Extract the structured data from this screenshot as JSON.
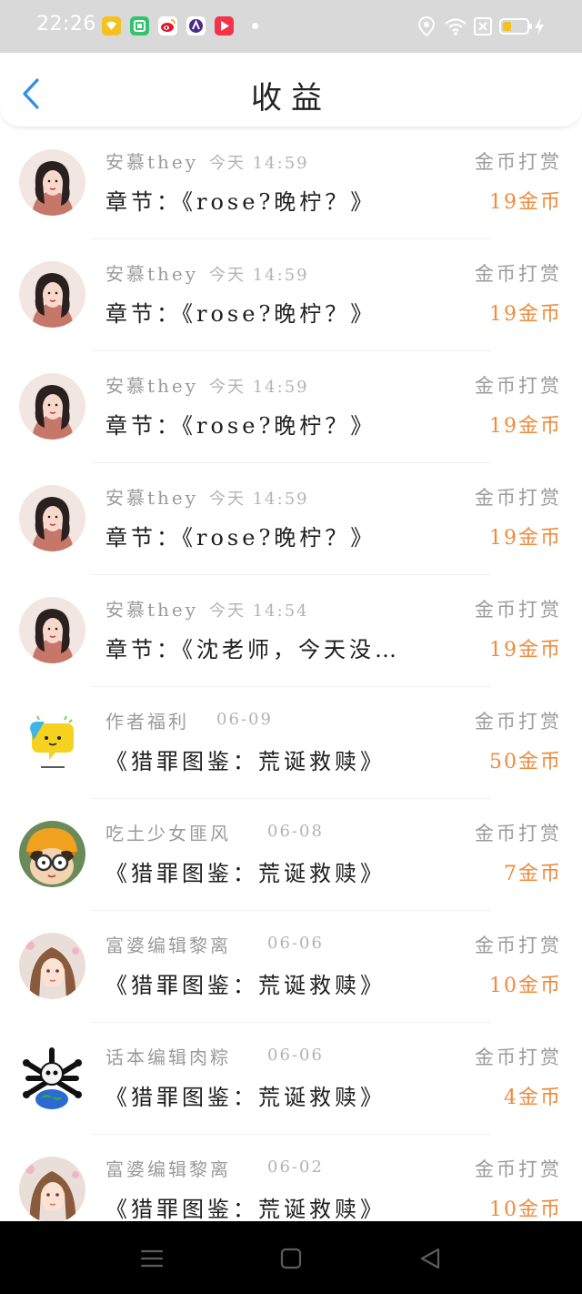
{
  "status_bar": {
    "time": "22:26",
    "notification_icons": [
      "yellow-app-icon",
      "green-app-icon",
      "weibo-icon",
      "purple-app-icon",
      "red-play-icon"
    ],
    "system_icons": [
      "location-icon",
      "wifi-icon",
      "no-sim-icon",
      "battery-icon",
      "charging-icon"
    ]
  },
  "header": {
    "title": "收益",
    "back_icon": "chevron-left-icon"
  },
  "accent_color": "#2f8ee8",
  "amount_color": "#f08a3c",
  "rows": [
    {
      "user": "安慕they",
      "time": "今天 14:59",
      "type": "金币打赏",
      "chapter": "章节：《rose?晚柠？》",
      "amount": "19金币",
      "avatar": "girl-avatar"
    },
    {
      "user": "安慕they",
      "time": "今天 14:59",
      "type": "金币打赏",
      "chapter": "章节：《rose?晚柠？》",
      "amount": "19金币",
      "avatar": "girl-avatar"
    },
    {
      "user": "安慕they",
      "time": "今天 14:59",
      "type": "金币打赏",
      "chapter": "章节：《rose?晚柠？》",
      "amount": "19金币",
      "avatar": "girl-avatar"
    },
    {
      "user": "安慕they",
      "time": "今天 14:59",
      "type": "金币打赏",
      "chapter": "章节：《rose?晚柠？》",
      "amount": "19金币",
      "avatar": "girl-avatar"
    },
    {
      "user": "安慕they",
      "time": "今天 14:54",
      "type": "金币打赏",
      "chapter": "章节：《沈老师，今天没…",
      "amount": "19金币",
      "avatar": "girl-avatar"
    },
    {
      "user": "作者福利",
      "time": "06-09",
      "type": "金币打赏",
      "chapter": "《猎罪图鉴：荒诞救赎》",
      "amount": "50金币",
      "avatar": "chat-bubble-avatar"
    },
    {
      "user": "吃土少女匪风",
      "time": "06-08",
      "type": "金币打赏",
      "chapter": "《猎罪图鉴：荒诞救赎》",
      "amount": "7金币",
      "avatar": "cartoon-glasses-avatar"
    },
    {
      "user": "富婆编辑黎离",
      "time": "06-06",
      "type": "金币打赏",
      "chapter": "《猎罪图鉴：荒诞救赎》",
      "amount": "10金币",
      "avatar": "anime-girl-avatar"
    },
    {
      "user": "话本编辑肉粽",
      "time": "06-06",
      "type": "金币打赏",
      "chapter": "《猎罪图鉴：荒诞救赎》",
      "amount": "4金币",
      "avatar": "skull-globe-avatar"
    },
    {
      "user": "富婆编辑黎离",
      "time": "06-02",
      "type": "金币打赏",
      "chapter": "《猎罪图鉴：荒诞救赎》",
      "amount": "10金币",
      "avatar": "anime-girl-avatar"
    }
  ],
  "nav_bar": {
    "buttons": [
      "menu-icon",
      "home-icon",
      "back-triangle-icon"
    ]
  }
}
